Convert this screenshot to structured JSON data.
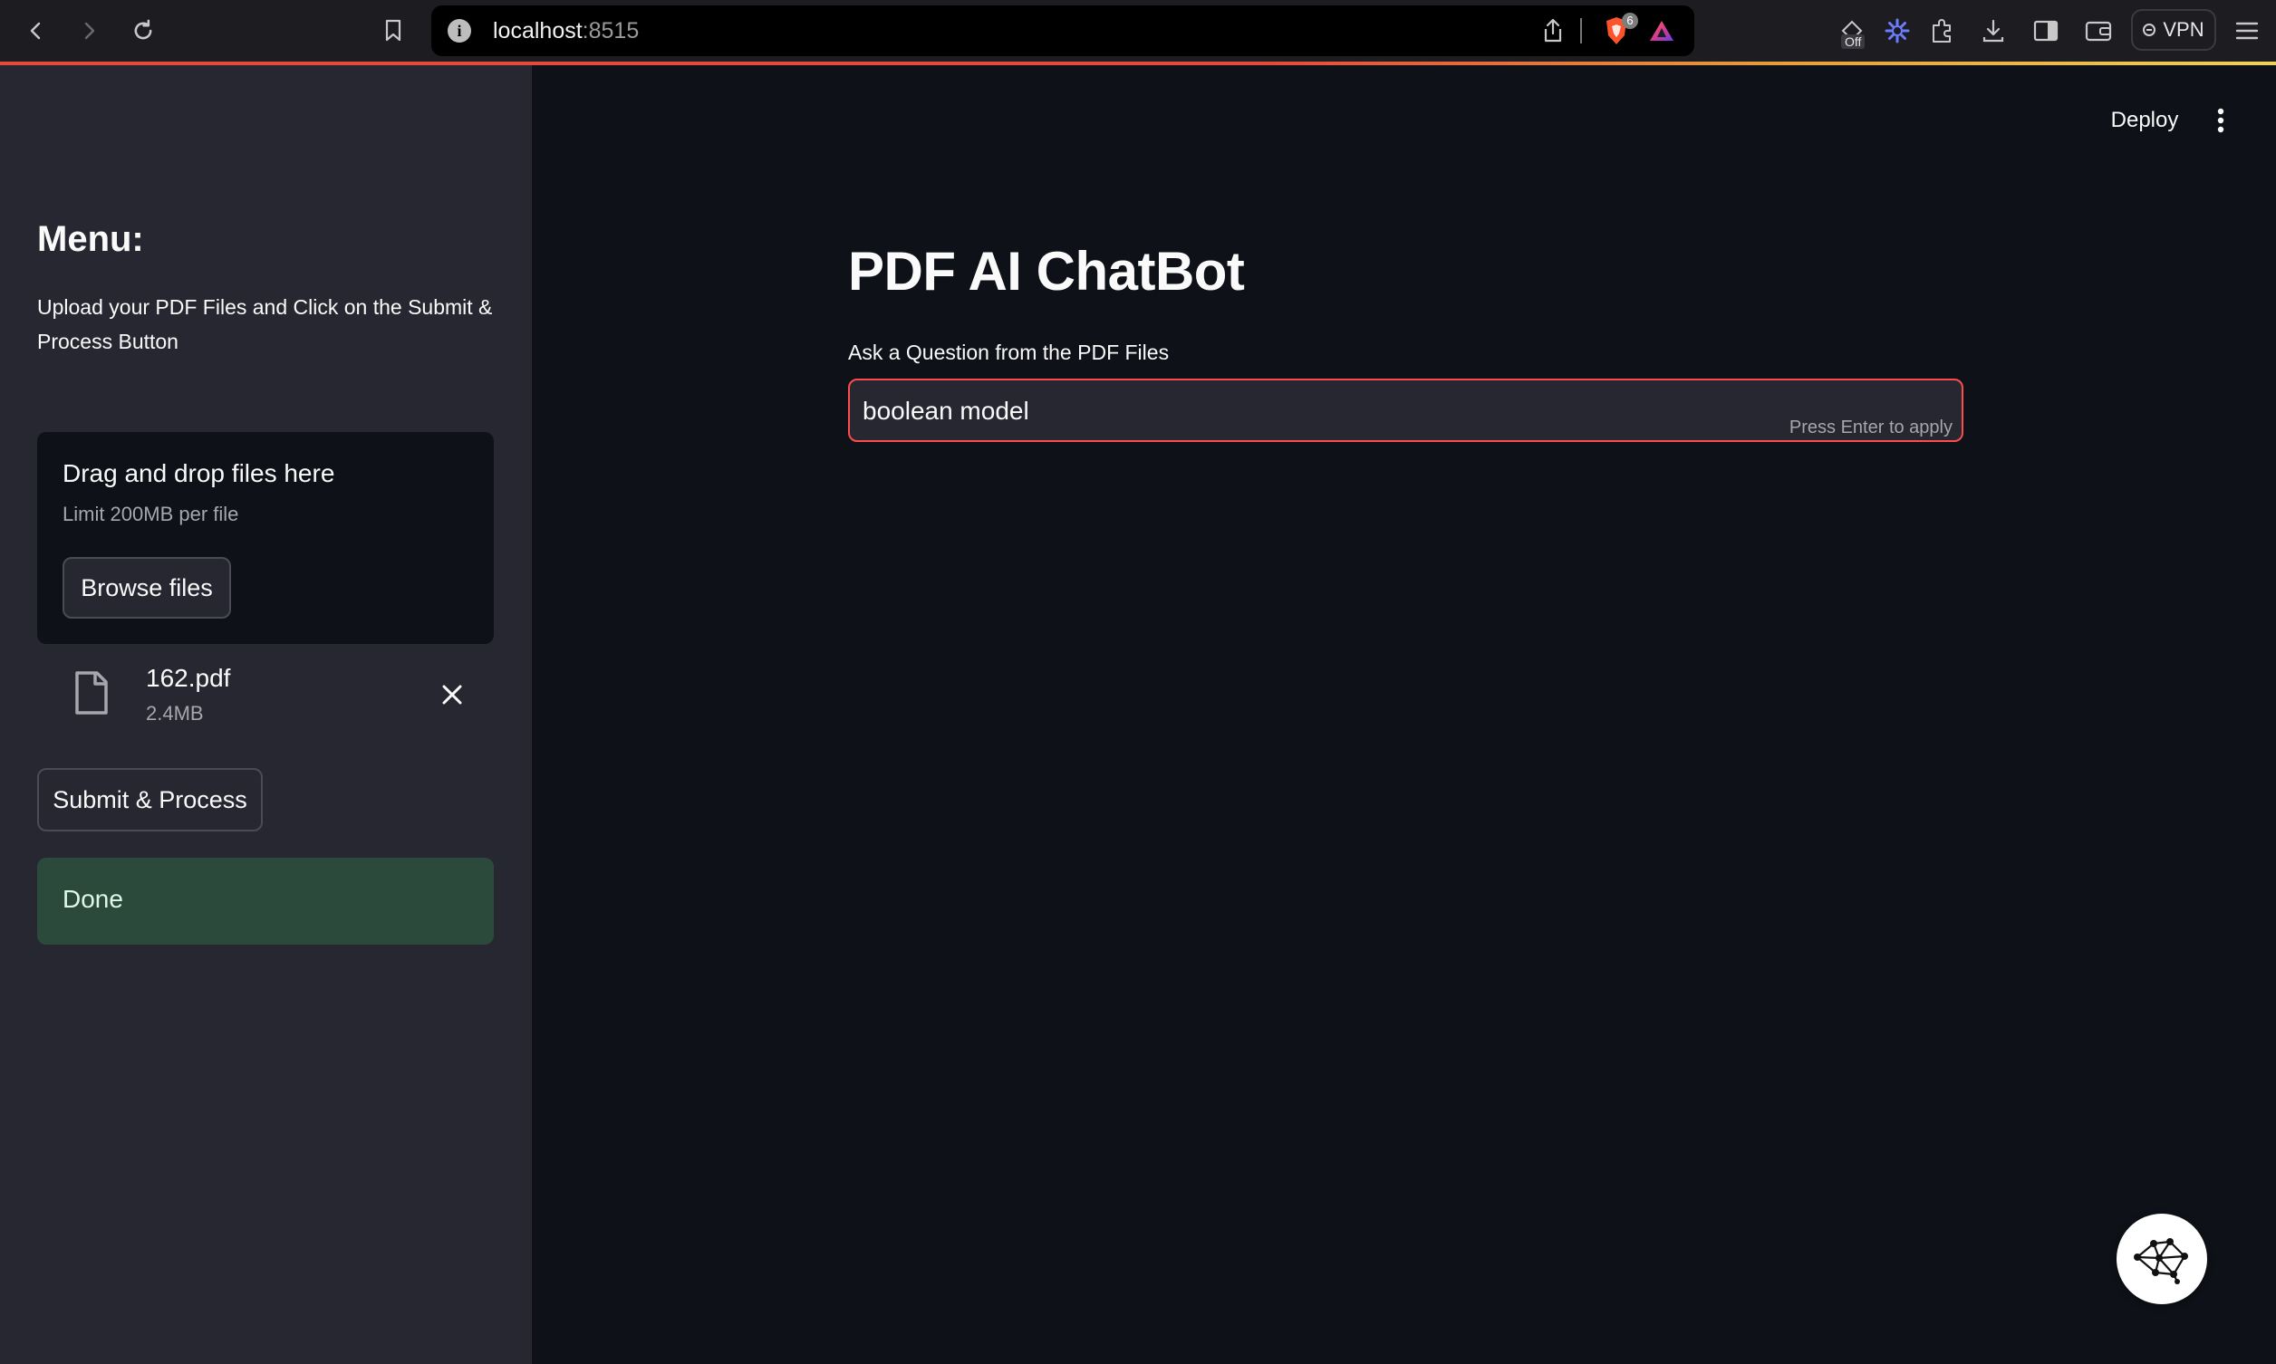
{
  "browser": {
    "url_host": "localhost",
    "url_port": ":8515",
    "shields_count": "6",
    "vpn_label": "VPN",
    "off_badge": "Off"
  },
  "header": {
    "deploy_label": "Deploy"
  },
  "sidebar": {
    "heading": "Menu:",
    "description": "Upload your PDF Files and Click on the Submit & Process Button",
    "uploader": {
      "drop_title": "Drag and drop files here",
      "limit_text": "Limit 200MB per file",
      "browse_label": "Browse files"
    },
    "file": {
      "name": "162.pdf",
      "size": "2.4MB"
    },
    "submit_label": "Submit & Process",
    "status_text": "Done"
  },
  "main": {
    "title": "PDF AI ChatBot",
    "question_label": "Ask a Question from the PDF Files",
    "question_value": "boolean model",
    "input_hint": "Press Enter to apply"
  },
  "colors": {
    "app_bg": "#0e1117",
    "sidebar_bg": "#262730",
    "accent_red": "#ff4b4b",
    "success_bg": "#2b4a3c"
  }
}
